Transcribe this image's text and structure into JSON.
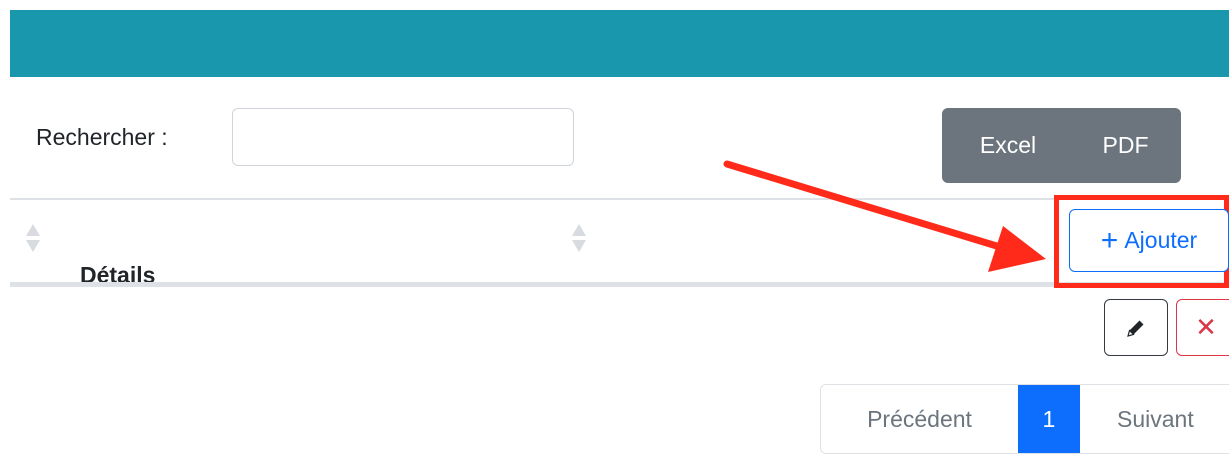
{
  "search": {
    "label": "Rechercher :",
    "value": "",
    "placeholder": ""
  },
  "export": {
    "excel_label": "Excel",
    "pdf_label": "PDF"
  },
  "table": {
    "columns": [
      {
        "label": "Détails"
      }
    ]
  },
  "actions": {
    "add_label": "Ajouter",
    "add_icon": "+",
    "edit_icon": "pencil-icon",
    "delete_icon": "✕"
  },
  "pagination": {
    "prev_label": "Précédent",
    "current_page": "1",
    "next_label": "Suivant"
  },
  "colors": {
    "header_bar": "#1897ad",
    "primary": "#0d6efd",
    "secondary": "#6c757d",
    "danger": "#dc3545",
    "annotation": "#ff2a1a"
  }
}
